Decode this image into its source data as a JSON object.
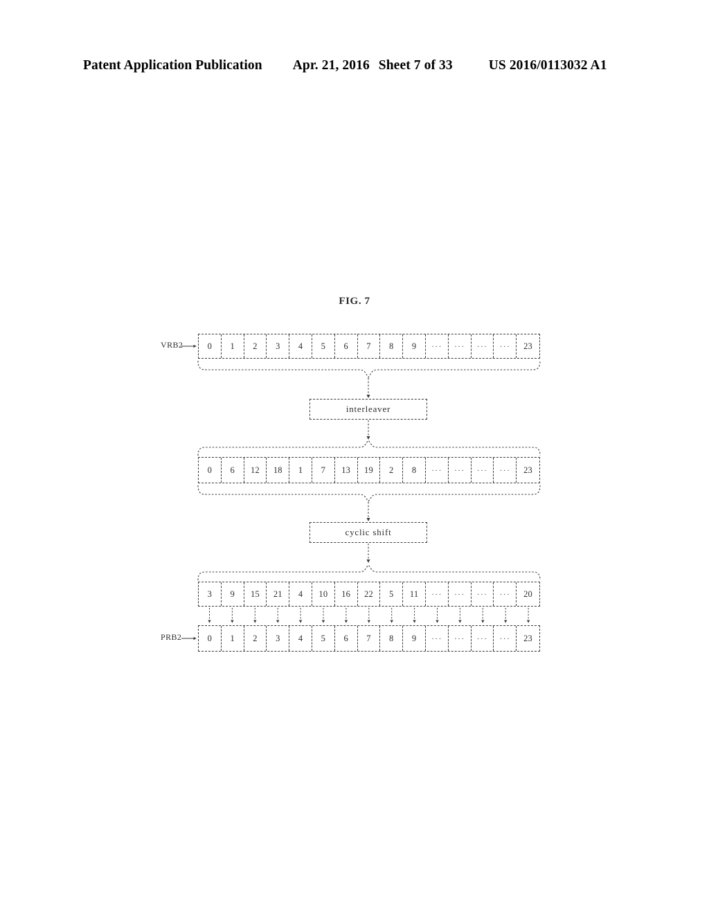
{
  "header": {
    "publication": "Patent Application Publication",
    "date": "Apr. 21, 2016",
    "sheet": "Sheet 7 of 33",
    "patent_number": "US 2016/0113032 A1"
  },
  "figure": {
    "title": "FIG. 7",
    "labels": {
      "input": "VRB2",
      "output": "PRB2"
    },
    "process_blocks": {
      "interleaver": "interleaver",
      "cyclic_shift": "cyclic shift"
    },
    "rows": {
      "vrb": {
        "name": "virtual-resource-block-row",
        "cells": [
          "0",
          "1",
          "2",
          "3",
          "4",
          "5",
          "6",
          "7",
          "8",
          "9",
          "···",
          "···",
          "···",
          "···",
          "23"
        ]
      },
      "interleaved": {
        "name": "interleaved-row",
        "cells": [
          "0",
          "6",
          "12",
          "18",
          "1",
          "7",
          "13",
          "19",
          "2",
          "8",
          "···",
          "···",
          "···",
          "···",
          "23"
        ]
      },
      "shifted": {
        "name": "cyclic-shifted-row",
        "cells": [
          "3",
          "9",
          "15",
          "21",
          "4",
          "10",
          "16",
          "22",
          "5",
          "11",
          "···",
          "···",
          "···",
          "···",
          "20"
        ]
      },
      "prb": {
        "name": "physical-resource-block-row",
        "cells": [
          "0",
          "1",
          "2",
          "3",
          "4",
          "5",
          "6",
          "7",
          "8",
          "9",
          "···",
          "···",
          "···",
          "···",
          "23"
        ]
      }
    },
    "colors": {
      "line": "#3a3a3a",
      "text": "#2d2d2d",
      "background": "#ffffff"
    }
  }
}
